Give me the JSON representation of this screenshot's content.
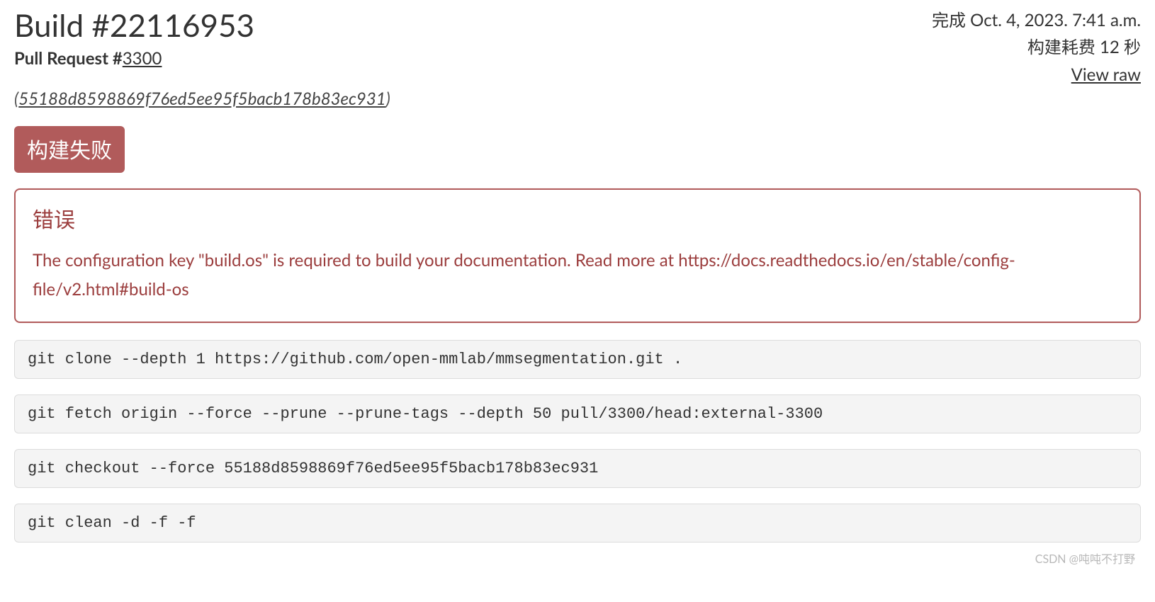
{
  "header": {
    "title": "Build #22116953",
    "pr_prefix": "Pull Request #",
    "pr_number": "3300",
    "commit_hash": "55188d8598869f76ed5ee95f5bacb178b83ec931"
  },
  "meta": {
    "completed_text": "完成 Oct. 4, 2023. 7:41 a.m.",
    "duration_text": "构建耗费 12 秒",
    "view_raw": "View raw"
  },
  "status": {
    "label": "构建失败"
  },
  "error": {
    "title": "错误",
    "message": "The configuration key \"build.os\" is required to build your documentation. Read more at https://docs.readthedocs.io/en/stable/config-file/v2.html#build-os"
  },
  "commands": [
    "git clone --depth 1 https://github.com/open-mmlab/mmsegmentation.git .",
    "git fetch origin --force --prune --prune-tags --depth 50 pull/3300/head:external-3300",
    "git checkout --force 55188d8598869f76ed5ee95f5bacb178b83ec931",
    "git clean -d -f -f"
  ],
  "watermark": "CSDN @吨吨不打野"
}
